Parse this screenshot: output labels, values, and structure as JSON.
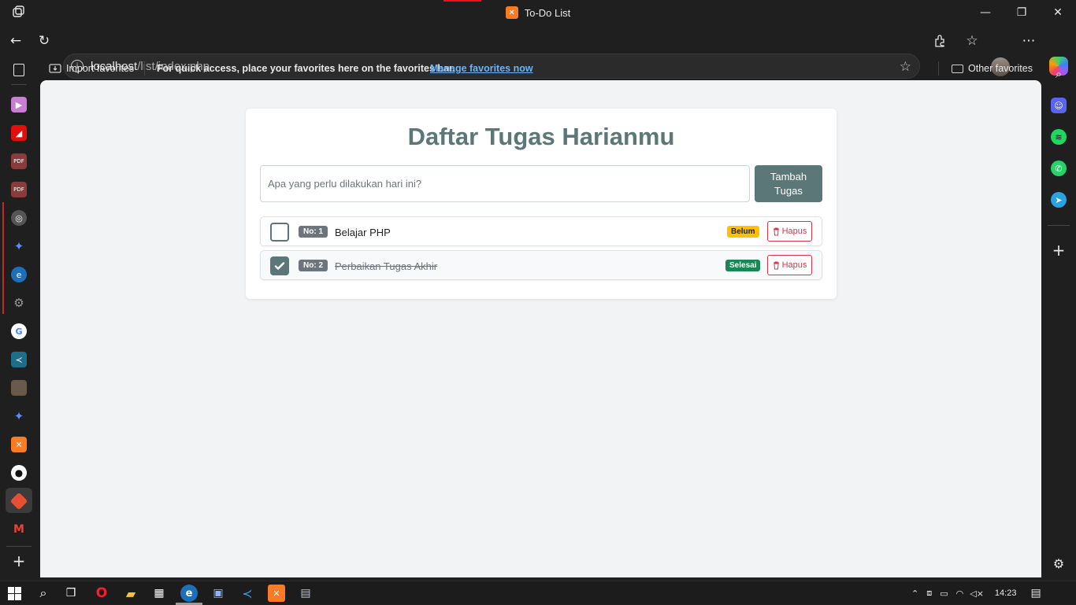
{
  "window": {
    "title": "To-Do List",
    "controls": {
      "minimize": "—",
      "maximize": "❐",
      "close": "✕"
    }
  },
  "toolbar": {
    "url_host": "localhost",
    "url_path": "/list/index.php"
  },
  "favorites_bar": {
    "import_label": "Import favorites",
    "message": "For quick access, place your favorites here on the favorites bar.",
    "manage_link": "Manage favorites now",
    "other_label": "Other favorites"
  },
  "left_sidebar": {
    "icons": [
      "tabs-icon",
      "play-icon",
      "pdf-app-icon",
      "pdf-icon",
      "pdf-icon",
      "chatgpt-icon",
      "gemini-icon",
      "edge-icon",
      "settings-icon",
      "google-icon",
      "vscode-icon",
      "photo-icon",
      "gemini-icon",
      "xampp-icon",
      "github-icon",
      "git-icon",
      "gmail-icon",
      "add-icon"
    ]
  },
  "right_sidebar": {
    "icons": [
      "search-icon",
      "discord-icon",
      "spotify-icon",
      "whatsapp-icon",
      "telegram-icon",
      "add-icon",
      "settings-icon"
    ]
  },
  "app": {
    "heading": "Daftar Tugas Harianmu",
    "input_placeholder": "Apa yang perlu dilakukan hari ini?",
    "add_button": "Tambah\nTugas",
    "tasks": [
      {
        "number": "No: 1",
        "name": "Belajar PHP",
        "status": "Belum",
        "done": false,
        "delete_label": "Hapus"
      },
      {
        "number": "No: 2",
        "name": "Perbaikan Tugas Akhir",
        "status": "Selesai",
        "done": true,
        "delete_label": "Hapus"
      }
    ]
  },
  "taskbar": {
    "clock": "14:23",
    "apps": [
      "windows-start-icon",
      "search-icon",
      "task-view-icon",
      "opera-icon",
      "file-explorer-icon",
      "store-icon",
      "edge-icon",
      "photos-icon",
      "vscode-icon",
      "xampp-icon",
      "notepad-icon"
    ]
  },
  "colors": {
    "accent": "#5b7778",
    "warning": "#ffc107",
    "success": "#198754",
    "danger": "#dc3545"
  }
}
